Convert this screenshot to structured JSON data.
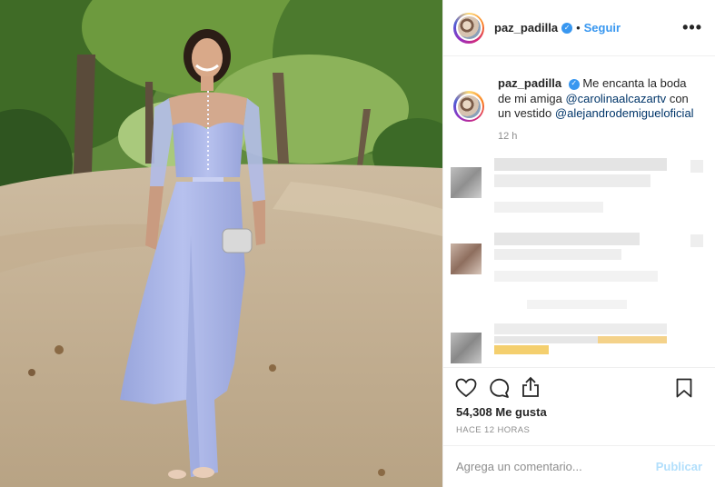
{
  "post": {
    "username": "paz_padilla",
    "follow_label": "Seguir",
    "more_label": "•••",
    "caption_username": "paz_padilla",
    "caption_text_1": "Me encanta la boda de mi amiga",
    "mention_1": "@carolinaalcazartv",
    "caption_text_2": "con un vestido",
    "mention_2": "@alejandrodemigueloficial",
    "caption_time": "12 h",
    "likes": "54,308 Me gusta",
    "time_ago": "HACE 12 HORAS",
    "comment_placeholder": "Agrega un comentario...",
    "publish_label": "Publicar",
    "verified_glyph": "✓"
  },
  "icons": [
    "heart-icon",
    "comment-icon",
    "share-icon",
    "bookmark-icon",
    "verified-icon"
  ],
  "colors": {
    "link": "#3897f0",
    "mention": "#003569",
    "publish_disabled": "#b2dffc",
    "muted": "#8e8e8e",
    "dress": "#a8b4e6"
  }
}
